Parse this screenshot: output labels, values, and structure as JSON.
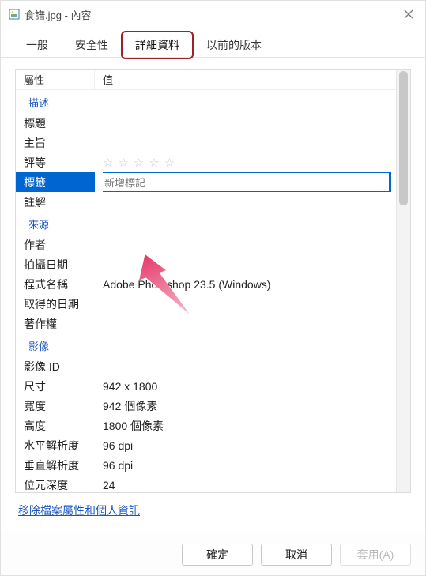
{
  "window": {
    "title": "食譜.jpg - 內容"
  },
  "tabs": {
    "general": "一般",
    "security": "安全性",
    "details": "詳細資料",
    "previous": "以前的版本"
  },
  "header": {
    "property": "屬性",
    "value": "值"
  },
  "sections": {
    "description": "描述",
    "origin": "來源",
    "image": "影像"
  },
  "rows": {
    "title": {
      "k": "標題",
      "v": ""
    },
    "subject": {
      "k": "主旨",
      "v": ""
    },
    "rating": {
      "k": "評等"
    },
    "tags": {
      "k": "標籤",
      "placeholder": "新增標記"
    },
    "comments": {
      "k": "註解",
      "v": ""
    },
    "author": {
      "k": "作者",
      "v": ""
    },
    "date_taken": {
      "k": "拍攝日期",
      "v": ""
    },
    "program": {
      "k": "程式名稱",
      "v": "Adobe Photoshop 23.5 (Windows)"
    },
    "acquired": {
      "k": "取得的日期",
      "v": ""
    },
    "copyright": {
      "k": "著作權",
      "v": ""
    },
    "image_id": {
      "k": "影像 ID",
      "v": ""
    },
    "dimensions": {
      "k": "尺寸",
      "v": "942 x 1800"
    },
    "width": {
      "k": "寬度",
      "v": "942 個像素"
    },
    "height": {
      "k": "高度",
      "v": "1800 個像素"
    },
    "hres": {
      "k": "水平解析度",
      "v": "96 dpi"
    },
    "vres": {
      "k": "垂直解析度",
      "v": "96 dpi"
    },
    "bitdepth": {
      "k": "位元深度",
      "v": "24"
    }
  },
  "link": "移除檔案屬性和個人資訊",
  "buttons": {
    "ok": "確定",
    "cancel": "取消",
    "apply": "套用(A)"
  }
}
